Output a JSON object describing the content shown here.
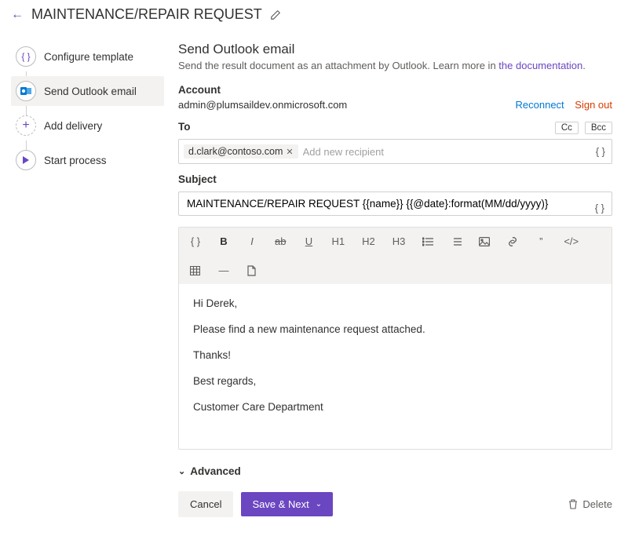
{
  "header": {
    "title": "MAINTENANCE/REPAIR REQUEST"
  },
  "sidebar": {
    "items": [
      {
        "label": "Configure template"
      },
      {
        "label": "Send Outlook email"
      },
      {
        "label": "Add delivery"
      },
      {
        "label": "Start process"
      }
    ]
  },
  "panel": {
    "title": "Send Outlook email",
    "description_prefix": "Send the result document as an attachment by Outlook. Learn more in ",
    "description_link": "the documentation",
    "description_suffix": "."
  },
  "account": {
    "label": "Account",
    "email": "admin@plumsaildev.onmicrosoft.com",
    "reconnect": "Reconnect",
    "signout": "Sign out"
  },
  "to": {
    "label": "To",
    "cc": "Cc",
    "bcc": "Bcc",
    "chip": "d.clark@contoso.com",
    "placeholder": "Add new recipient"
  },
  "subject": {
    "label": "Subject",
    "value": "MAINTENANCE/REPAIR REQUEST {{name}} {{@date}:format(MM/dd/yyyy)}"
  },
  "toolbar": {
    "braces": "{ }",
    "bold": "B",
    "italic": "I",
    "strike": "ab",
    "under": "U",
    "h1": "H1",
    "h2": "H2",
    "h3": "H3",
    "quote": "”",
    "code": "</>"
  },
  "body": {
    "p1": "Hi Derek,",
    "p2": "Please find a new maintenance request attached.",
    "p3": "Thanks!",
    "p4": "Best regards,",
    "p5": "Customer Care Department"
  },
  "advanced": {
    "label": "Advanced"
  },
  "footer": {
    "cancel": "Cancel",
    "save": "Save & Next",
    "delete": "Delete"
  }
}
